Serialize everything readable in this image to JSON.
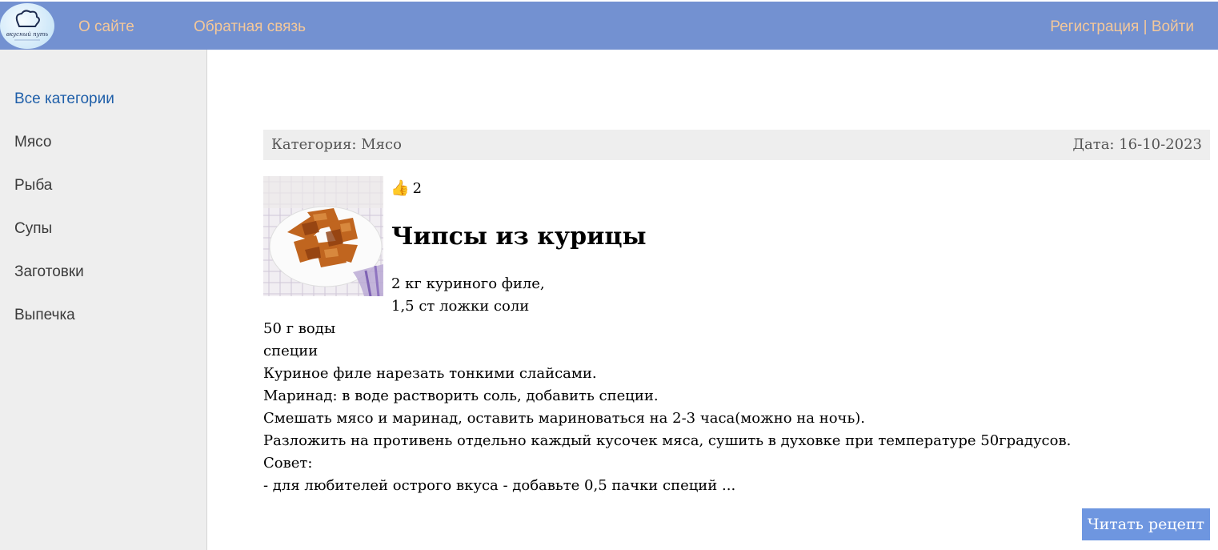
{
  "header": {
    "logo_alt": "вкусный путь",
    "nav": [
      {
        "label": "О сайте"
      },
      {
        "label": "Обратная связь"
      }
    ],
    "auth": {
      "register": "Регистрация",
      "separator": " | ",
      "login": "Войти"
    },
    "colors": {
      "bar": "#7391d1",
      "link": "#f4c89a"
    }
  },
  "sidebar": {
    "items": [
      {
        "label": "Все категории",
        "active": true
      },
      {
        "label": "Мясо"
      },
      {
        "label": "Рыба"
      },
      {
        "label": "Супы"
      },
      {
        "label": "Заготовки"
      },
      {
        "label": "Выпечка"
      }
    ]
  },
  "post": {
    "category": "Категория: Мясо",
    "date": "Дата: 16-10-2023",
    "likes_icon": "thumbs-up-icon",
    "likes": "2",
    "title": "Чипсы из курицы",
    "lines": [
      "2 кг куриного филе,",
      "1,5 ст ложки соли",
      "50 г воды",
      "специи",
      "Куриное филе нарезать тонкими слайсами.",
      "Маринад: в воде растворить соль, добавить специи.",
      "Смешать мясо и маринад, оставить мариноваться на 2-3 часа(можно на ночь).",
      "Разложить на противень отдельно каждый кусочек мяса, сушить в духовке при температуре 50градусов.",
      "Совет:",
      "- для любителей острого вкуса - добавьте 0,5 пачки специй ..."
    ],
    "read_button": "Читать рецепт"
  }
}
